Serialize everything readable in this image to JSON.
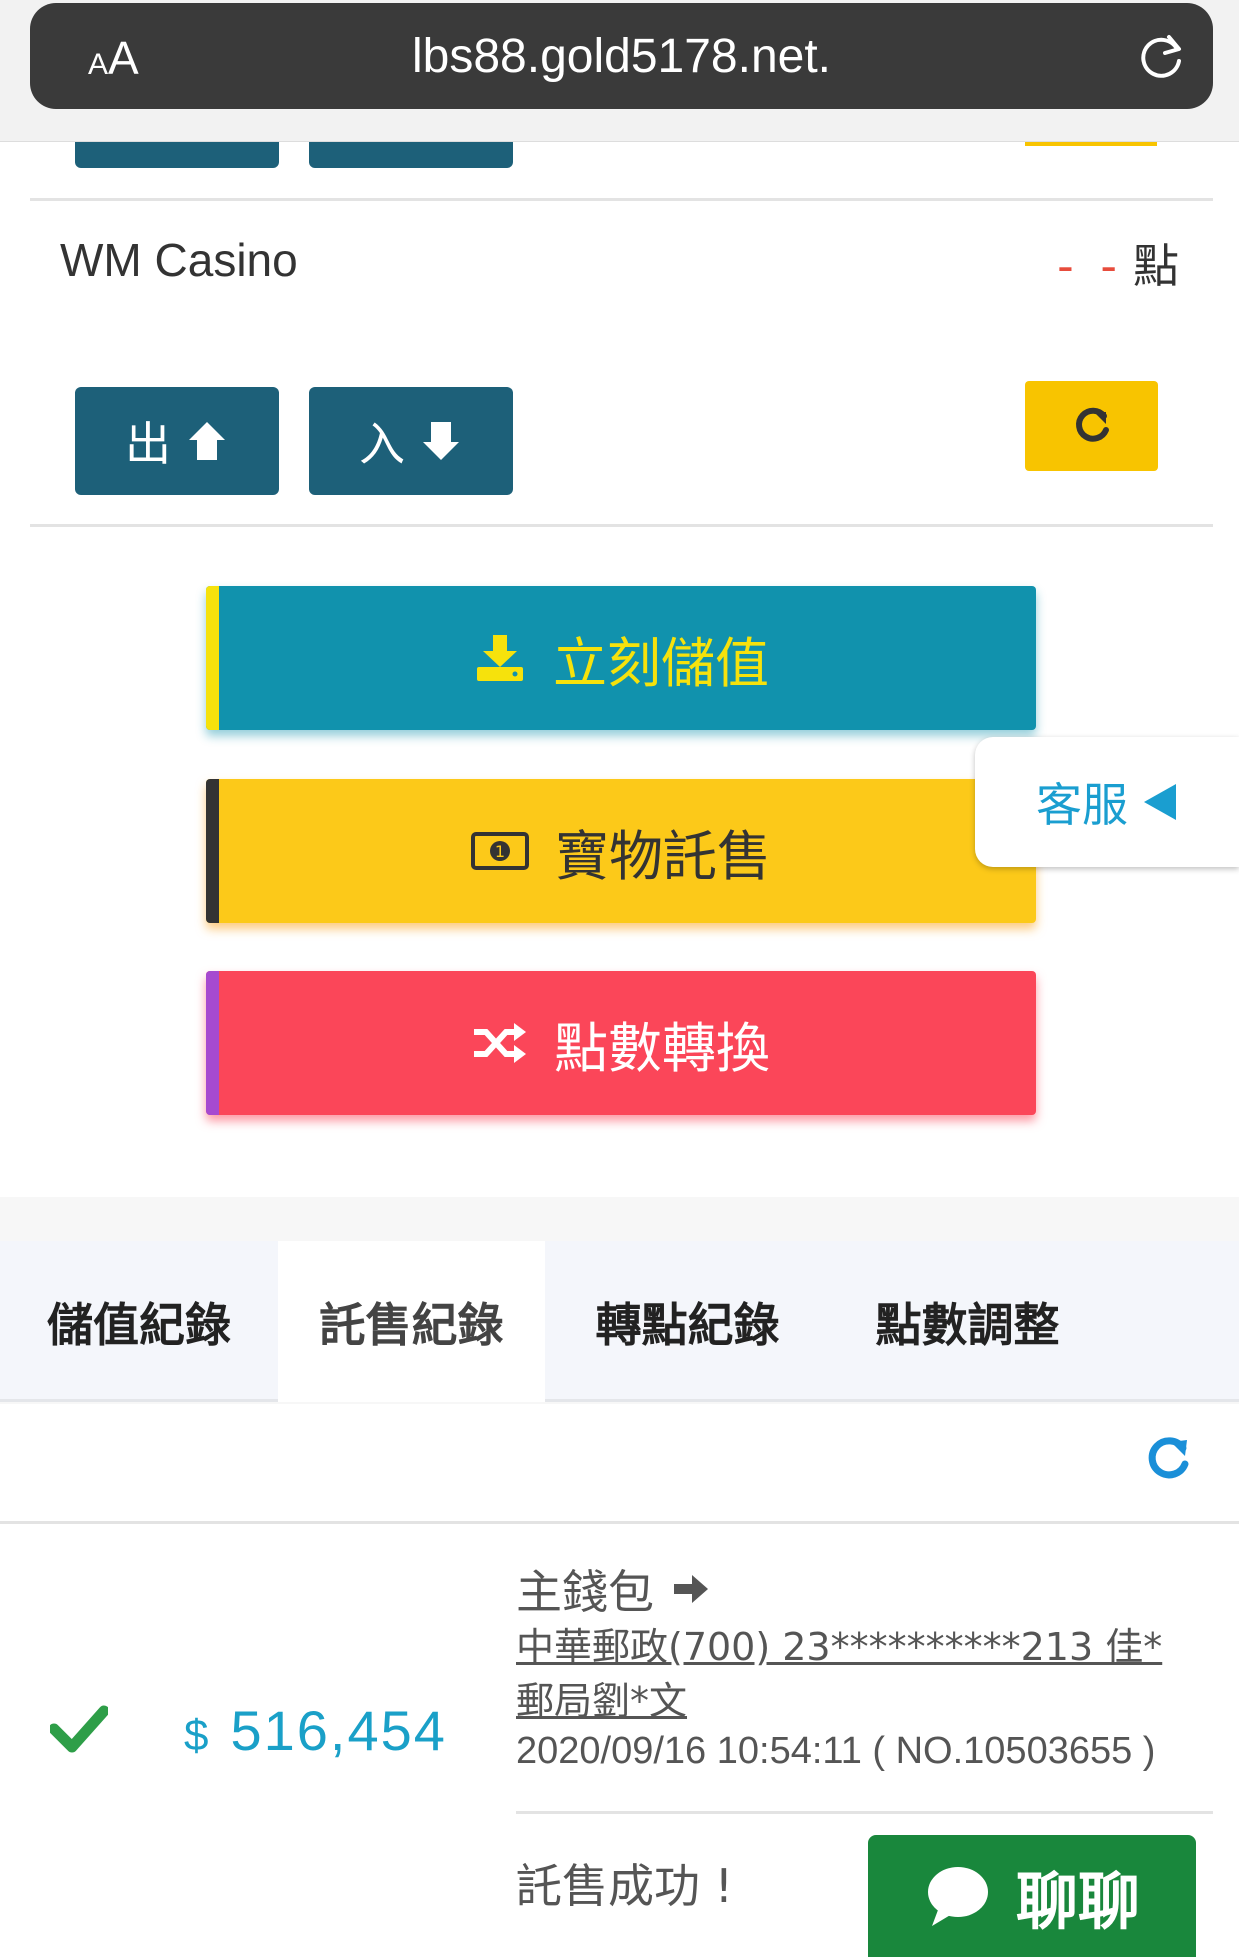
{
  "browser": {
    "text_size_label": "AA",
    "url": "lbs88.gold5178.net."
  },
  "game": {
    "name": "WM Casino",
    "points_value": "- -",
    "points_unit": "點",
    "out_label": "出",
    "in_label": "入"
  },
  "actions": {
    "deposit_label": "立刻儲值",
    "consign_label": "寶物託售",
    "convert_label": "點數轉換"
  },
  "customer_service": {
    "label": "客服"
  },
  "tabs": [
    {
      "label": "儲值紀錄"
    },
    {
      "label": "託售紀錄"
    },
    {
      "label": "轉點紀錄"
    },
    {
      "label": "點數調整"
    }
  ],
  "record": {
    "currency_symbol": "$",
    "amount": "516,454",
    "wallet_label": "主錢包",
    "bank_detail": "中華郵政(700) 23**********213 佳*郵局劉*文",
    "timestamp": "2020/09/16 10:54:11 ( NO.10503655 )",
    "status_text": "託售成功 !"
  },
  "chat": {
    "label": "聊聊"
  },
  "colors": {
    "dark_teal": "#1d6079",
    "deposit_blue": "#1192ad",
    "consign_yellow": "#fcc919",
    "convert_red": "#fb4659",
    "accent_cyan": "#1aa0c8",
    "chat_green": "#19873c"
  }
}
